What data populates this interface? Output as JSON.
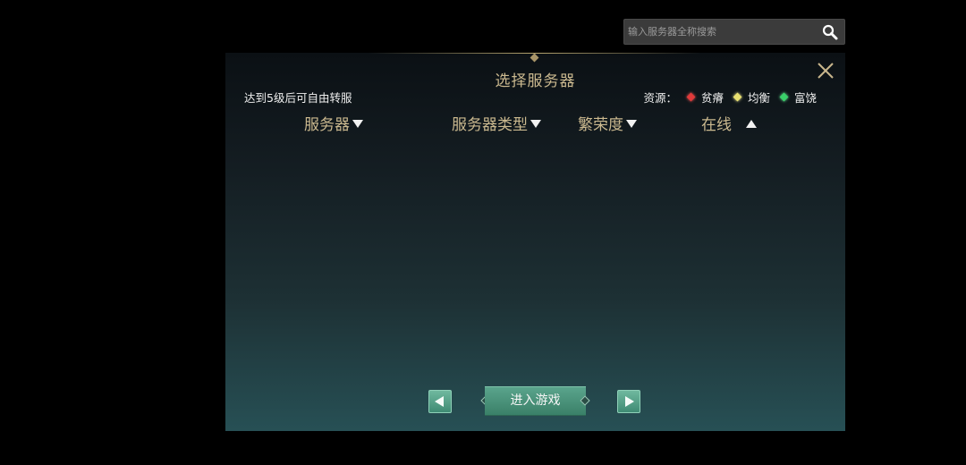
{
  "search": {
    "placeholder": "输入服务器全称搜索",
    "icon": "search-icon"
  },
  "panel": {
    "title": "选择服务器",
    "hint": "达到5级后可自由转服",
    "resources": {
      "label": "资源：",
      "items": [
        {
          "label": "贫瘠",
          "color": "#e03a3a"
        },
        {
          "label": "均衡",
          "color": "#e8e070"
        },
        {
          "label": "富饶",
          "color": "#3ad06a"
        }
      ]
    },
    "columns": [
      {
        "label": "服务器",
        "sort": "down"
      },
      {
        "label": "服务器类型",
        "sort": "down"
      },
      {
        "label": "繁荣度",
        "sort": "down"
      },
      {
        "label": "在线",
        "sort": "up"
      }
    ],
    "servers": [],
    "enter_label": "进入游戏",
    "close_icon": "close-icon"
  },
  "colors": {
    "accent_gold": "#cbb98f",
    "button_green": "#4a9a80"
  }
}
